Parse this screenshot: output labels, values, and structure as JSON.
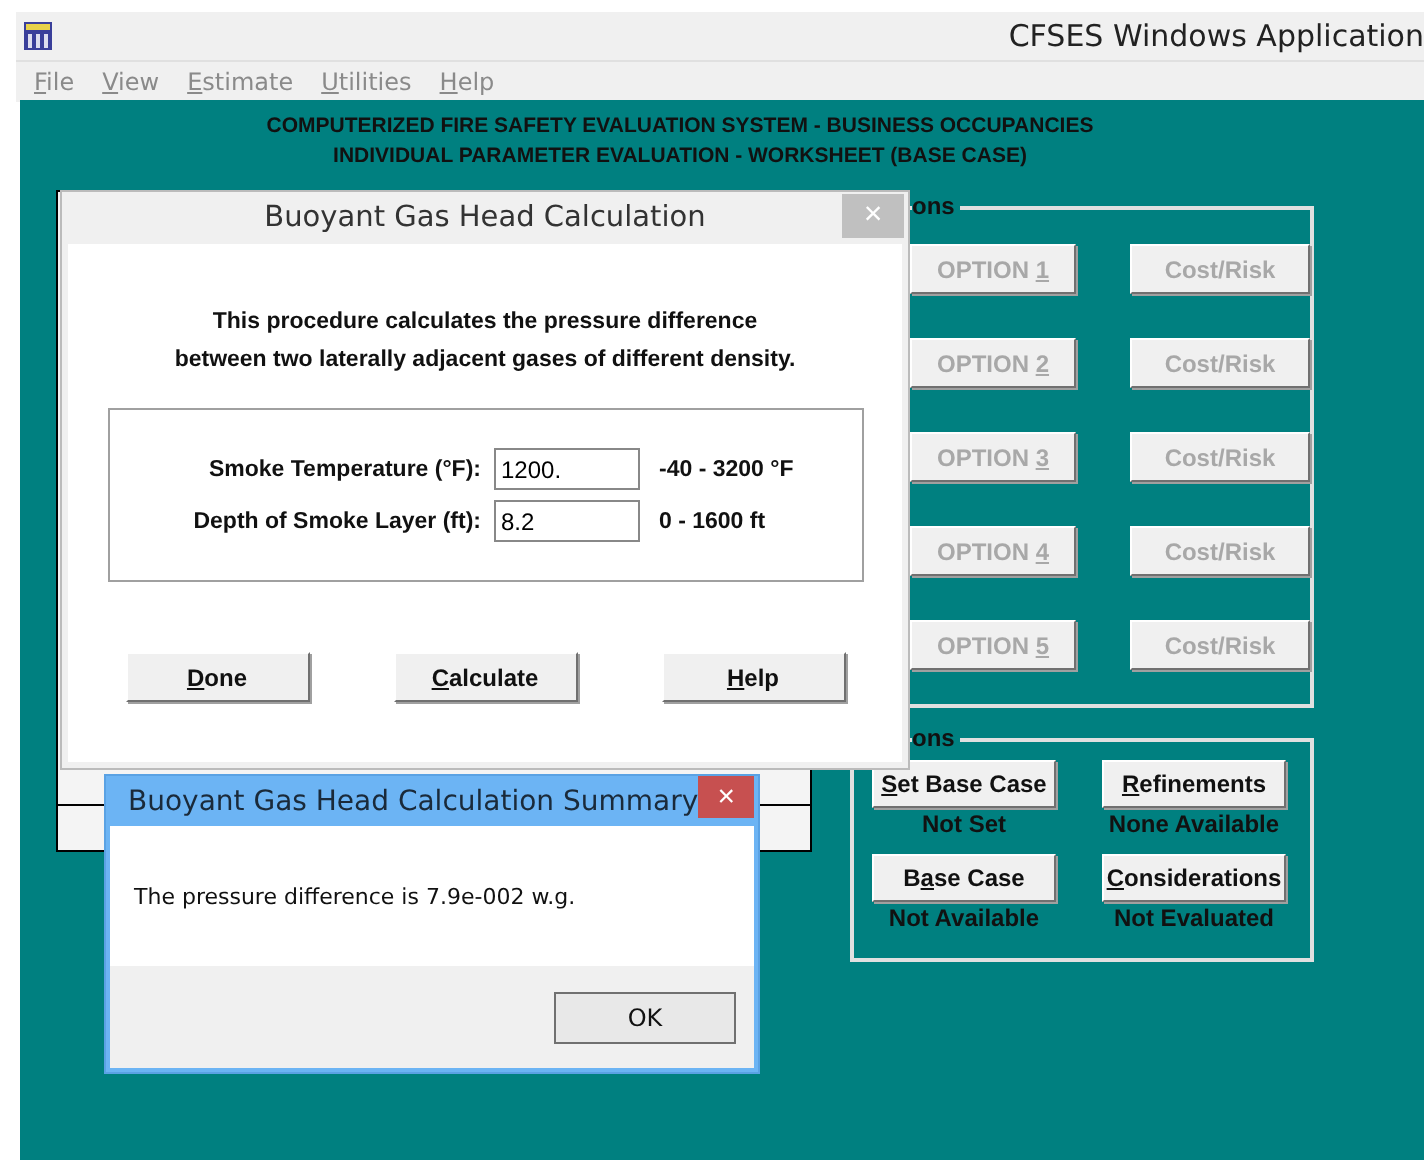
{
  "app_window": {
    "title": "CFSES Windows Application"
  },
  "menu": [
    {
      "mnemonic": "F",
      "after": "ile"
    },
    {
      "mnemonic": "V",
      "after": "iew"
    },
    {
      "mnemonic": "E",
      "after": "stimate"
    },
    {
      "mnemonic": "U",
      "after": "tilities"
    },
    {
      "mnemonic": "H",
      "after": "elp"
    }
  ],
  "header": [
    "COMPUTERIZED FIRE SAFETY EVALUATION SYSTEM - BUSINESS OCCUPANCIES",
    "INDIVIDUAL PARAMETER EVALUATION - WORKSHEET (BASE CASE)"
  ],
  "options_group": {
    "label": "ons",
    "rows": [
      [
        {
          "before": "OPTION ",
          "mnemonic": "1",
          "disabled": true
        },
        {
          "before": "Cost/Risk",
          "disabled": true
        }
      ],
      [
        {
          "before": "OPTION ",
          "mnemonic": "2",
          "disabled": true
        },
        {
          "before": "Cost/Risk",
          "disabled": true
        }
      ],
      [
        {
          "before": "OPTION ",
          "mnemonic": "3",
          "disabled": true
        },
        {
          "before": "Cost/Risk",
          "disabled": true
        }
      ],
      [
        {
          "before": "OPTION ",
          "mnemonic": "4",
          "disabled": true
        },
        {
          "before": "Cost/Risk",
          "disabled": true
        }
      ],
      [
        {
          "before": "OPTION ",
          "mnemonic": "5",
          "disabled": true
        },
        {
          "before": "Cost/Risk",
          "disabled": true
        }
      ]
    ]
  },
  "actions_group": {
    "label": "ons",
    "items": [
      {
        "mnemonic": "S",
        "after": "et Base Case",
        "disabled": false,
        "status": "Not Set"
      },
      {
        "mnemonic": "R",
        "after": "efinements",
        "disabled": false,
        "status": "None Available"
      },
      {
        "before": "B",
        "mnemonic": "a",
        "after": "se Case",
        "disabled": false,
        "status": "Not Available"
      },
      {
        "mnemonic": "C",
        "after": "onsiderations",
        "disabled": false,
        "status": "Not Evaluated"
      }
    ]
  },
  "calc_dialog": {
    "title": "Buoyant Gas Head Calculation",
    "close": "×",
    "description": [
      "This procedure calculates the pressure difference",
      "between two laterally adjacent gases of different density."
    ],
    "fields": [
      {
        "label": "Smoke Temperature (°F):",
        "value": "1200.",
        "range": "-40 - 3200 °F"
      },
      {
        "label": "Depth of Smoke Layer (ft):",
        "value": "8.2",
        "range": "0 - 1600 ft"
      }
    ],
    "buttons": [
      {
        "mnemonic": "D",
        "after": "one"
      },
      {
        "mnemonic": "C",
        "after": "alculate"
      },
      {
        "mnemonic": "H",
        "after": "elp"
      }
    ]
  },
  "summary_dialog": {
    "title": "Buoyant Gas Head Calculation Summary",
    "close": "×",
    "message": "The pressure difference is 7.9e-002 w.g.",
    "button": "OK"
  }
}
